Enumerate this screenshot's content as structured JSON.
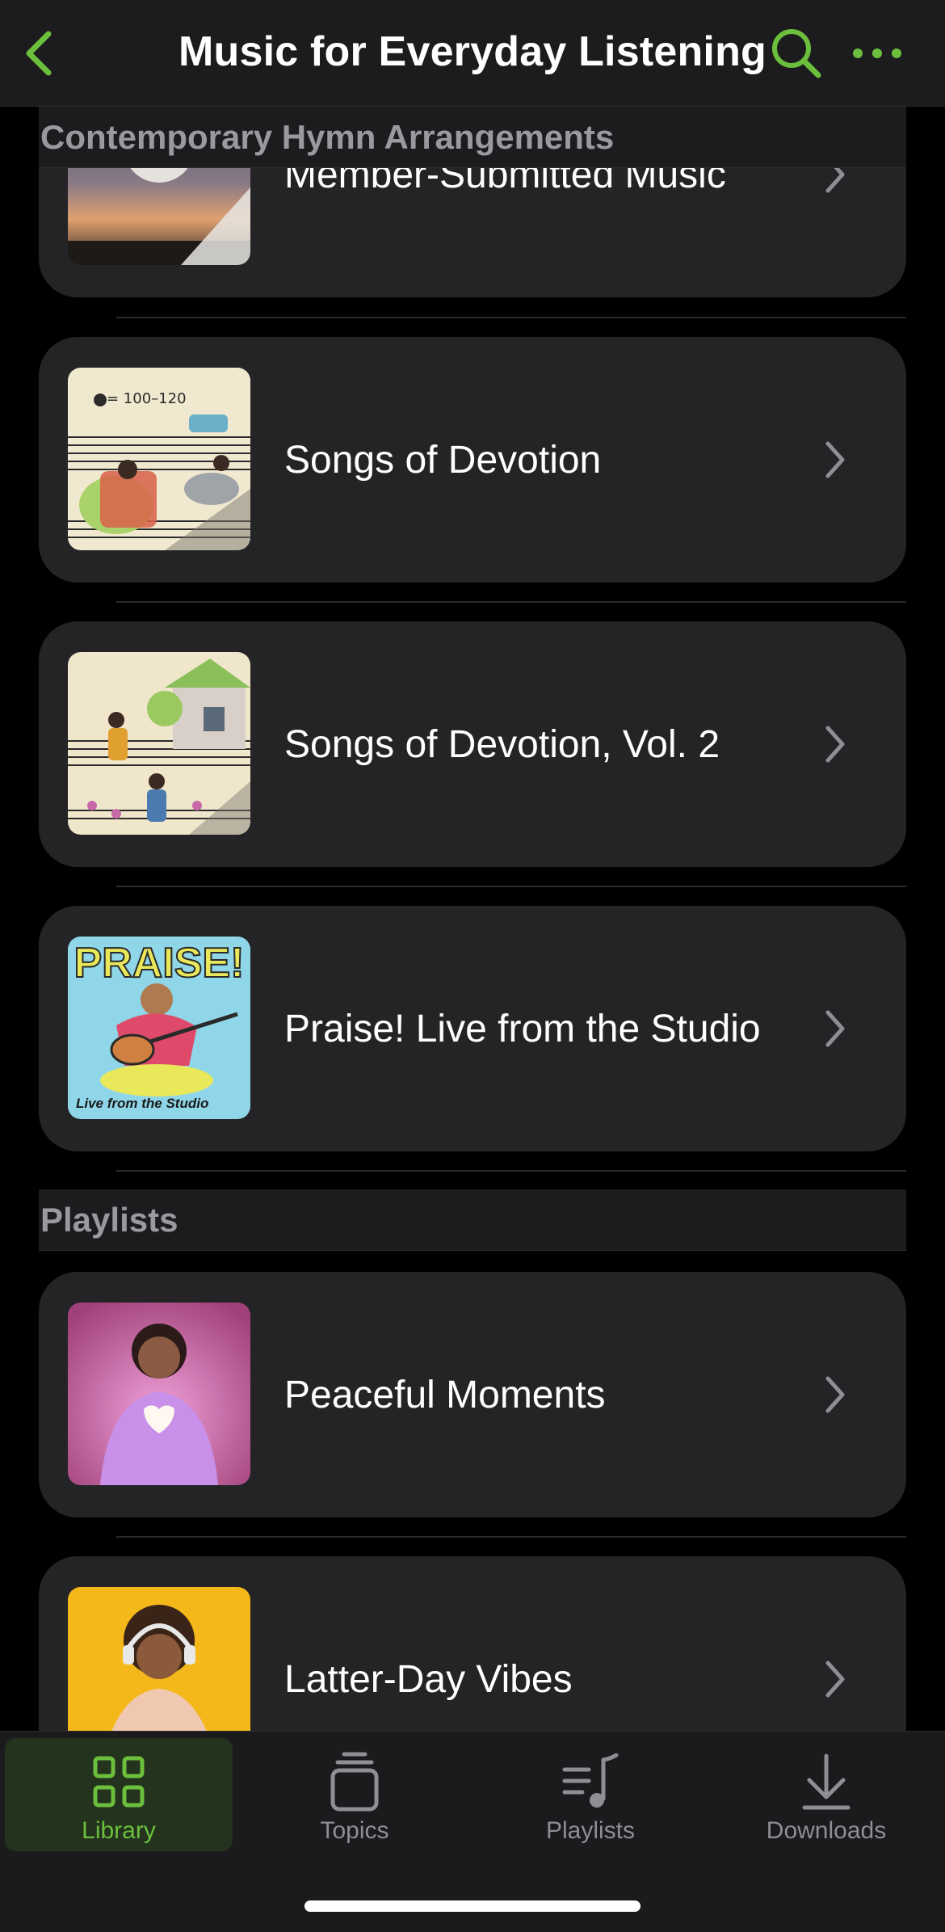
{
  "header": {
    "title": "Music for Everyday Listening",
    "accent_color": "#6cbf3c",
    "back_icon": "chevron-left-icon",
    "search_icon": "search-icon",
    "more_icon": "ellipsis-icon"
  },
  "sections": {
    "contemporary": "Contemporary Hymn Arrangements",
    "playlists": "Playlists"
  },
  "items": [
    {
      "title": "Member-Submitted Music"
    },
    {
      "title": "Songs of Devotion"
    },
    {
      "title": "Songs of Devotion, Vol. 2"
    },
    {
      "title": "Praise! Live from the Studio",
      "art_text": "PRAISE!",
      "art_caption": "Live from the Studio"
    },
    {
      "title": "Peaceful Moments"
    },
    {
      "title": "Latter-Day Vibes"
    }
  ],
  "art_annotations": {
    "tempo": "= 100–120"
  },
  "tabs": [
    {
      "label": "Library",
      "icon": "grid-icon",
      "active": true
    },
    {
      "label": "Topics",
      "icon": "topics-icon",
      "active": false
    },
    {
      "label": "Playlists",
      "icon": "playlist-icon",
      "active": false
    },
    {
      "label": "Downloads",
      "icon": "download-icon",
      "active": false
    }
  ]
}
